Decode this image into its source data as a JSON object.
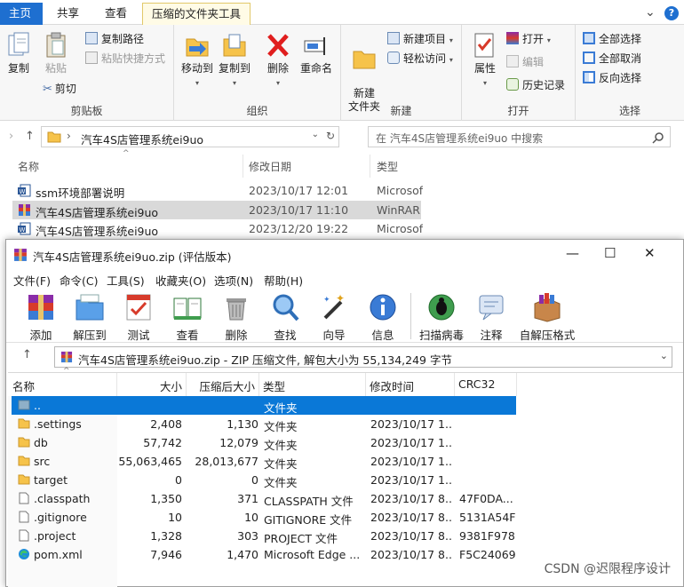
{
  "explorer": {
    "tabs": [
      "主页",
      "共享",
      "查看",
      "压缩的文件夹工具"
    ],
    "ribbon": {
      "clipboard": {
        "label": "剪贴板",
        "copy": "复制",
        "paste": "粘贴",
        "copy_path": "复制路径",
        "paste_shortcut": "粘贴快捷方式",
        "cut": "剪切"
      },
      "organize": {
        "label": "组织",
        "move_to": "移动到",
        "copy_to": "复制到",
        "delete": "删除",
        "rename": "重命名"
      },
      "new": {
        "label": "新建",
        "new_folder": "新建\n文件夹",
        "new_item": "新建项目",
        "easy_access": "轻松访问"
      },
      "open": {
        "label": "打开",
        "properties": "属性",
        "open": "打开",
        "edit": "编辑",
        "history": "历史记录"
      },
      "select": {
        "label": "选择",
        "select_all": "全部选择",
        "select_none": "全部取消",
        "invert": "反向选择"
      }
    },
    "address": "汽车4S店管理系统ei9uo",
    "search_placeholder": "在 汽车4S店管理系统ei9uo 中搜索",
    "columns": {
      "name": "名称",
      "date": "修改日期",
      "type": "类型"
    },
    "files": [
      {
        "name": "ssm环境部署说明",
        "date": "2023/10/17 12:01",
        "type": "Microsoft",
        "icon": "word-doc-icon"
      },
      {
        "name": "汽车4S店管理系统ei9uo",
        "date": "2023/10/17 11:10",
        "type": "WinRAR",
        "icon": "winrar-archive-icon",
        "selected": true
      },
      {
        "name": "汽车4S店管理系统ei9uo",
        "date": "2023/12/20 19:22",
        "type": "Microsoft",
        "icon": "word-doc-icon"
      }
    ]
  },
  "winrar": {
    "title": "汽车4S店管理系统ei9uo.zip (评估版本)",
    "menu": [
      "文件(F)",
      "命令(C)",
      "工具(S)",
      "收藏夹(O)",
      "选项(N)",
      "帮助(H)"
    ],
    "toolbar": [
      "添加",
      "解压到",
      "测试",
      "查看",
      "删除",
      "查找",
      "向导",
      "信息",
      "扫描病毒",
      "注释",
      "自解压格式"
    ],
    "path": "汽车4S店管理系统ei9uo.zip - ZIP 压缩文件, 解包大小为 55,134,249 字节",
    "columns": {
      "name": "名称",
      "size": "大小",
      "packed": "压缩后大小",
      "type": "类型",
      "modified": "修改时间",
      "crc": "CRC32"
    },
    "rows": [
      {
        "name": "..",
        "size": "",
        "packed": "",
        "type": "文件夹",
        "modified": "",
        "crc": "",
        "icon": "parent-folder-icon",
        "selected": true
      },
      {
        "name": ".settings",
        "size": "2,408",
        "packed": "1,130",
        "type": "文件夹",
        "modified": "2023/10/17 1...",
        "crc": "",
        "icon": "folder-icon"
      },
      {
        "name": "db",
        "size": "57,742",
        "packed": "12,079",
        "type": "文件夹",
        "modified": "2023/10/17 1...",
        "crc": "",
        "icon": "folder-icon"
      },
      {
        "name": "src",
        "size": "55,063,465",
        "packed": "28,013,677",
        "type": "文件夹",
        "modified": "2023/10/17 1...",
        "crc": "",
        "icon": "folder-icon"
      },
      {
        "name": "target",
        "size": "0",
        "packed": "0",
        "type": "文件夹",
        "modified": "2023/10/17 1...",
        "crc": "",
        "icon": "folder-icon"
      },
      {
        "name": ".classpath",
        "size": "1,350",
        "packed": "371",
        "type": "CLASSPATH 文件",
        "modified": "2023/10/17 8...",
        "crc": "47F0DA...",
        "icon": "file-icon"
      },
      {
        "name": ".gitignore",
        "size": "10",
        "packed": "10",
        "type": "GITIGNORE 文件",
        "modified": "2023/10/17 8...",
        "crc": "5131A54F",
        "icon": "file-icon"
      },
      {
        "name": ".project",
        "size": "1,328",
        "packed": "303",
        "type": "PROJECT 文件",
        "modified": "2023/10/17 8...",
        "crc": "9381F978",
        "icon": "file-icon"
      },
      {
        "name": "pom.xml",
        "size": "7,946",
        "packed": "1,470",
        "type": "Microsoft Edge ...",
        "modified": "2023/10/17 8...",
        "crc": "F5C24069",
        "icon": "edge-icon"
      }
    ]
  },
  "watermark": "CSDN @迟限程序设计"
}
